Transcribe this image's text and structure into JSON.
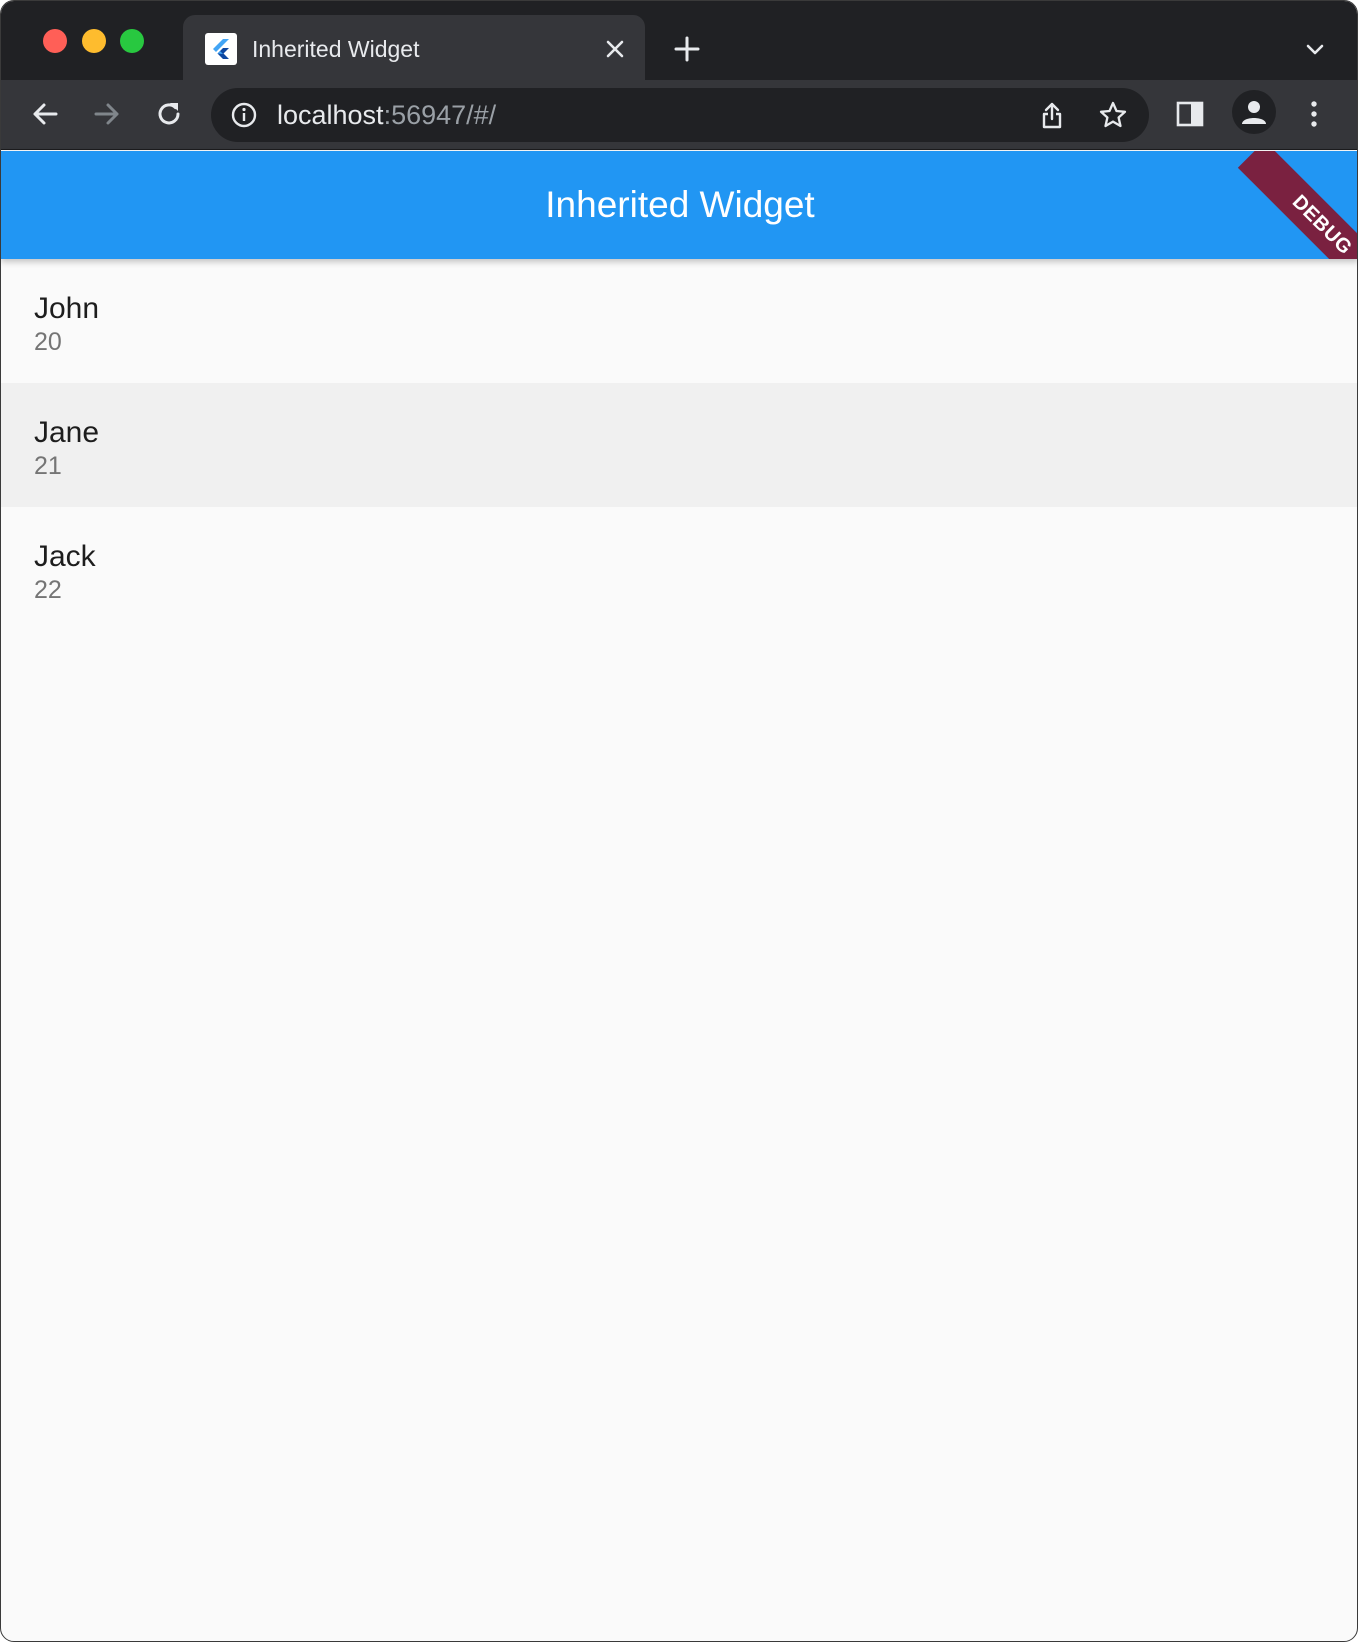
{
  "browser": {
    "tab": {
      "title": "Inherited Widget",
      "favicon": "flutter-logo-icon"
    },
    "omnibox": {
      "url_host": "localhost",
      "url_rest": ":56947/#/"
    },
    "icons": {
      "back": "arrow-left-icon",
      "forward": "arrow-right-icon",
      "reload": "reload-icon",
      "info": "info-icon",
      "share": "share-icon",
      "star": "star-icon",
      "sidepanel": "side-panel-icon",
      "profile": "profile-icon",
      "menu": "kebab-menu-icon",
      "new_tab": "plus-icon",
      "close_tab": "close-icon",
      "tab_search": "chevron-down-icon"
    }
  },
  "app": {
    "title": "Inherited Widget",
    "debug_banner": "DEBUG",
    "accent_color": "#2196f3",
    "people": [
      {
        "name": "John",
        "age": "20"
      },
      {
        "name": "Jane",
        "age": "21"
      },
      {
        "name": "Jack",
        "age": "22"
      }
    ]
  }
}
